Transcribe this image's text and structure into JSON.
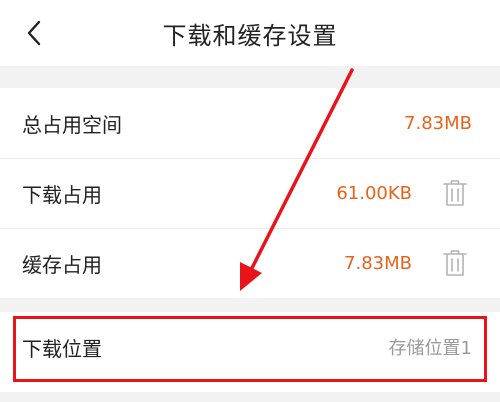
{
  "header": {
    "title": "下载和缓存设置",
    "back_icon": "chevron-left-icon"
  },
  "storage": {
    "rows": [
      {
        "label": "总占用空间",
        "value": "7.83MB"
      },
      {
        "label": "下载占用",
        "value": "61.00KB",
        "action_icon": "trash-icon"
      },
      {
        "label": "缓存占用",
        "value": "7.83MB",
        "action_icon": "trash-icon"
      }
    ]
  },
  "download_location": {
    "label": "下载位置",
    "value": "存储位置1"
  },
  "colors": {
    "accent": "#e8631a",
    "annotation": "#e8141a",
    "value_gray": "#9a9a9a",
    "background": "#f2f2f2"
  }
}
